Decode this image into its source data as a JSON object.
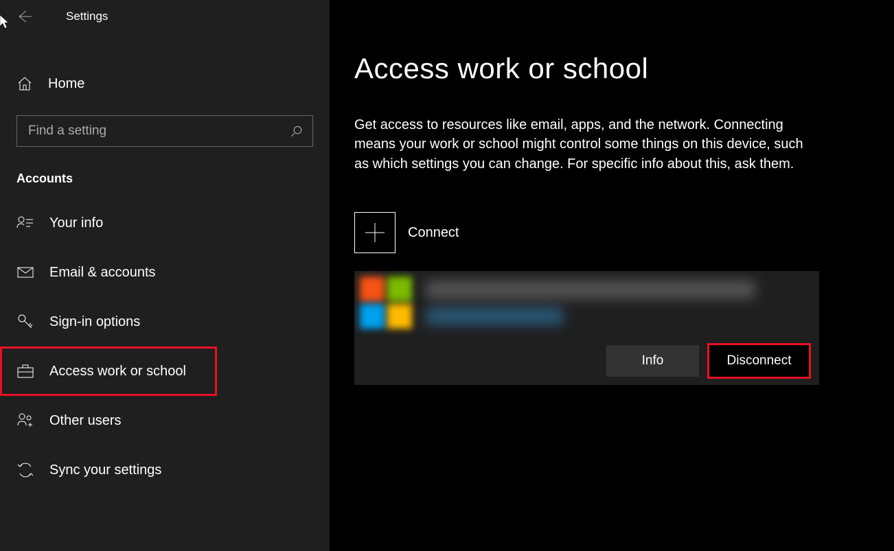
{
  "window": {
    "title": "Settings"
  },
  "sidebar": {
    "home_label": "Home",
    "search_placeholder": "Find a setting",
    "section_header": "Accounts",
    "items": [
      {
        "label": "Your info"
      },
      {
        "label": "Email & accounts"
      },
      {
        "label": "Sign-in options"
      },
      {
        "label": "Access work or school"
      },
      {
        "label": "Other users"
      },
      {
        "label": "Sync your settings"
      }
    ]
  },
  "main": {
    "title": "Access work or school",
    "description": "Get access to resources like email, apps, and the network. Connecting means your work or school might control some things on this device, such as which settings you can change. For specific info about this, ask them.",
    "connect_label": "Connect",
    "info_button": "Info",
    "disconnect_button": "Disconnect"
  }
}
